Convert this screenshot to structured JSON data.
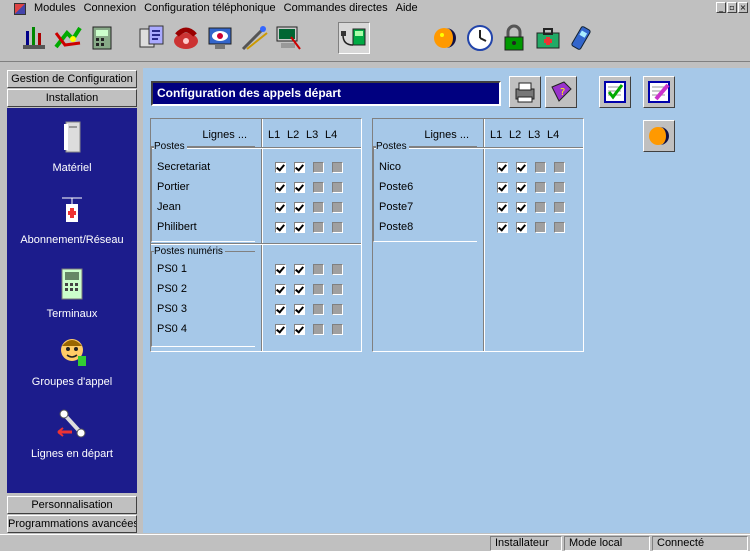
{
  "menu": {
    "items": [
      "Modules",
      "Connexion",
      "Configuration téléphonique",
      "Commandes directes",
      "Aide"
    ],
    "window_controls": [
      "_",
      "▫",
      "×"
    ]
  },
  "toolbar": {
    "buttons": [
      "antenna-icon",
      "routing-icon",
      "phone-list-icon",
      "config-icon",
      "phone-hand-icon",
      "monitor-eye-icon",
      "fax-wand-icon",
      "pc-config-icon",
      "dial-out-icon",
      "day-night-icon",
      "clock-icon",
      "lock-icon",
      "case-icon",
      "mobile-icon"
    ],
    "pressed": "dial-out-icon"
  },
  "left_panel": {
    "top_buttons": [
      "Gestion de Configuration",
      "Installation"
    ],
    "nav_items": [
      {
        "label": "Matériel",
        "icon": "hardware-icon"
      },
      {
        "label": "Abonnement/Réseau",
        "icon": "network-icon"
      },
      {
        "label": "Terminaux",
        "icon": "terminal-icon"
      },
      {
        "label": "Groupes d'appel",
        "icon": "group-icon"
      },
      {
        "label": "Lignes en départ",
        "icon": "outgoing-lines-icon"
      }
    ],
    "bottom_buttons": [
      "Personnalisation",
      "Programmations avancées"
    ],
    "nav_bg": "#1c1c8c"
  },
  "main": {
    "title": "Configuration des appels départ",
    "actions": [
      "print-icon",
      "help-book-icon",
      "validate-icon",
      "edit-icon",
      "day-night-icon"
    ],
    "lines_label": "Lignes ...",
    "columns": [
      "L1",
      "L2",
      "L3",
      "L4"
    ],
    "left_table": {
      "sections": [
        {
          "title": "Postes",
          "rows": [
            {
              "name": "Secretariat",
              "values": [
                true,
                true,
                false,
                false
              ]
            },
            {
              "name": "Portier",
              "values": [
                true,
                true,
                false,
                false
              ]
            },
            {
              "name": "Jean",
              "values": [
                true,
                true,
                false,
                false
              ]
            },
            {
              "name": "Philibert",
              "values": [
                true,
                true,
                false,
                false
              ]
            }
          ]
        },
        {
          "title": "Postes numéris",
          "rows": [
            {
              "name": "PS0 1",
              "values": [
                true,
                true,
                false,
                false
              ]
            },
            {
              "name": "PS0 2",
              "values": [
                true,
                true,
                false,
                false
              ]
            },
            {
              "name": "PS0 3",
              "values": [
                true,
                true,
                false,
                false
              ]
            },
            {
              "name": "PS0 4",
              "values": [
                true,
                true,
                false,
                false
              ]
            }
          ]
        }
      ]
    },
    "right_table": {
      "sections": [
        {
          "title": "Postes",
          "rows": [
            {
              "name": "Nico",
              "values": [
                true,
                true,
                false,
                false
              ]
            },
            {
              "name": "Poste6",
              "values": [
                true,
                true,
                false,
                false
              ]
            },
            {
              "name": "Poste7",
              "values": [
                true,
                true,
                false,
                false
              ]
            },
            {
              "name": "Poste8",
              "values": [
                true,
                true,
                false,
                false
              ]
            }
          ]
        }
      ]
    },
    "bg": "#a6c8e8"
  },
  "status": {
    "user": "Installateur",
    "mode": "Mode local",
    "connection": "Connecté"
  }
}
